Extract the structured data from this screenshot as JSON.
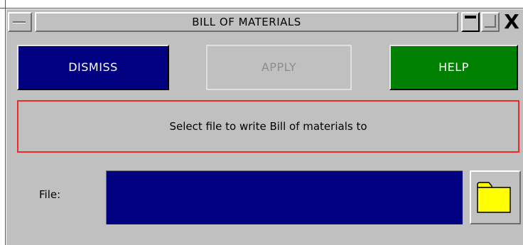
{
  "window": {
    "title": "BILL OF MATERIALS"
  },
  "titlebar": {
    "sysmenu_icon": "system-menu-icon",
    "minimize_icon": "minimize-icon",
    "maximize_icon": "maximize-icon",
    "close_glyph": "X"
  },
  "actions": {
    "dismiss_label": "DISMISS",
    "apply_label": "APPLY",
    "help_label": "HELP"
  },
  "message": {
    "text": "Select file to write Bill of materials to"
  },
  "file": {
    "label": "File:",
    "value": "",
    "browse_icon": "folder-icon"
  },
  "colors": {
    "panel": "#c0c0c0",
    "dismiss_bg": "#000080",
    "help_bg": "#008000",
    "field_bg": "#000080",
    "message_border": "#ee2a2a",
    "folder_fill": "#ffff00"
  }
}
